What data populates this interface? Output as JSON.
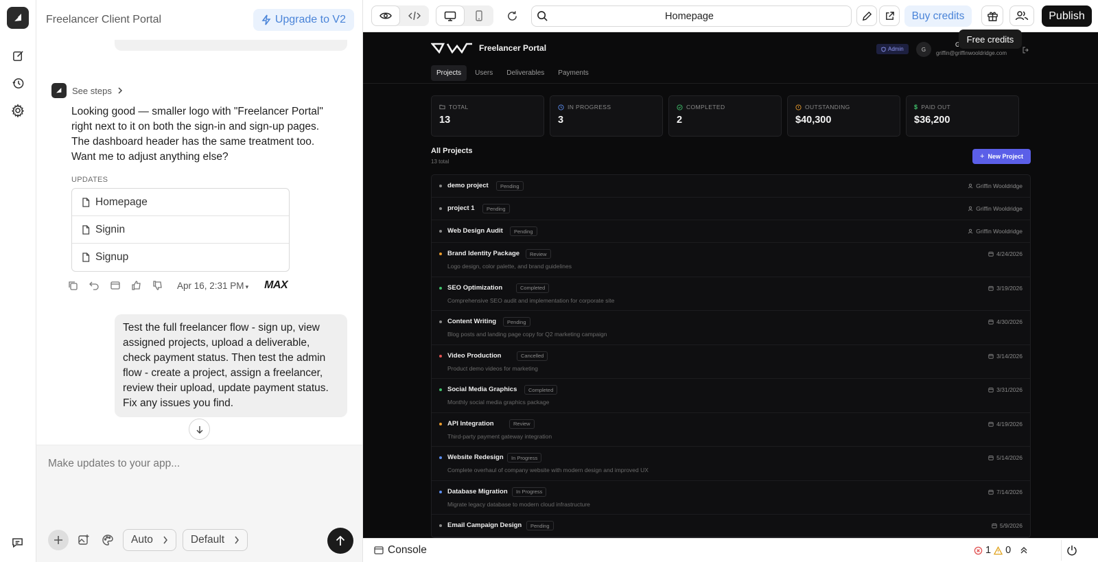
{
  "chat": {
    "title": "Freelancer Client Portal",
    "upgrade_label": "Upgrade to V2",
    "see_steps": "See steps",
    "assistant_message": "Looking good — smaller logo with \"Freelancer Portal\" right next to it on both the sign-in and sign-up pages. The dashboard header has the same treatment too. Want me to adjust anything else?",
    "updates_label": "UPDATES",
    "updated_files": [
      "Homepage",
      "Signin",
      "Signup"
    ],
    "timestamp": "Apr 16, 2:31 PM",
    "model_badge": "MAX",
    "user_message": "Test the full freelancer flow - sign up, view assigned projects, upload a deliverable, check payment status. Then test the admin flow - create a project, assign a freelancer, review their upload, update payment status. Fix any issues you find.",
    "composer_placeholder": "Make updates to your app...",
    "mode_pill": "Auto",
    "model_pill": "Default"
  },
  "toolbar": {
    "url_text": "Homepage",
    "buy_credits": "Buy credits",
    "publish": "Publish",
    "tooltip": "Free credits"
  },
  "app": {
    "brand_name": "Freelancer Portal",
    "admin_badge": "Admin",
    "avatar_initial": "G",
    "user_name_partial": "G",
    "user_email": "griffin@griffinwooldridge.com",
    "tabs": [
      "Projects",
      "Users",
      "Deliverables",
      "Payments"
    ],
    "active_tab": "Projects",
    "stats": [
      {
        "label": "TOTAL",
        "value": "13",
        "icon": "folder-icon",
        "color": "#8a8a8a"
      },
      {
        "label": "IN PROGRESS",
        "value": "3",
        "icon": "clock-icon",
        "color": "#5b8def"
      },
      {
        "label": "COMPLETED",
        "value": "2",
        "icon": "check-circle-icon",
        "color": "#3fbf6a"
      },
      {
        "label": "OUTSTANDING",
        "value": "$40,300",
        "icon": "alert-circle-icon",
        "color": "#e89a2c"
      },
      {
        "label": "PAID OUT",
        "value": "$36,200",
        "icon": "dollar-icon",
        "color": "#3fbf6a"
      }
    ],
    "projects_title": "All Projects",
    "projects_count": "13 total",
    "new_project": "New Project",
    "projects": [
      {
        "name": "demo project",
        "status": "Pending",
        "desc": "",
        "right": "Griffin Wooldridge",
        "right_icon": "user-icon",
        "dot": "#8a8a8a"
      },
      {
        "name": "project 1",
        "status": "Pending",
        "desc": "",
        "right": "Griffin Wooldridge",
        "right_icon": "user-icon",
        "dot": "#8a8a8a"
      },
      {
        "name": "Web Design Audit",
        "status": "Pending",
        "desc": "",
        "right": "Griffin Wooldridge",
        "right_icon": "user-icon",
        "dot": "#8a8a8a"
      },
      {
        "name": "Brand Identity Package",
        "status": "Review",
        "desc": "Logo design, color palette, and brand guidelines",
        "right": "4/24/2026",
        "right_icon": "calendar-icon",
        "dot": "#e89a2c"
      },
      {
        "name": "SEO Optimization",
        "status": "Completed",
        "desc": "Comprehensive SEO audit and implementation for corporate site",
        "right": "3/19/2026",
        "right_icon": "calendar-icon",
        "dot": "#3fbf6a"
      },
      {
        "name": "Content Writing",
        "status": "Pending",
        "desc": "Blog posts and landing page copy for Q2 marketing campaign",
        "right": "4/30/2026",
        "right_icon": "calendar-icon",
        "dot": "#8a8a8a"
      },
      {
        "name": "Video Production",
        "status": "Cancelled",
        "desc": "Product demo videos for marketing",
        "right": "3/14/2026",
        "right_icon": "calendar-icon",
        "dot": "#e05252"
      },
      {
        "name": "Social Media Graphics",
        "status": "Completed",
        "desc": "Monthly social media graphics package",
        "right": "3/31/2026",
        "right_icon": "calendar-icon",
        "dot": "#3fbf6a"
      },
      {
        "name": "API Integration",
        "status": "Review",
        "desc": "Third-party payment gateway integration",
        "right": "4/19/2026",
        "right_icon": "calendar-icon",
        "dot": "#e89a2c"
      },
      {
        "name": "Website Redesign",
        "status": "In Progress",
        "desc": "Complete overhaul of company website with modern design and improved UX",
        "right": "5/14/2026",
        "right_icon": "calendar-icon",
        "dot": "#5b8def"
      },
      {
        "name": "Database Migration",
        "status": "In Progress",
        "desc": "Migrate legacy database to modern cloud infrastructure",
        "right": "7/14/2026",
        "right_icon": "calendar-icon",
        "dot": "#5b8def"
      },
      {
        "name": "Email Campaign Design",
        "status": "Pending",
        "desc": "",
        "right": "5/9/2026",
        "right_icon": "calendar-icon",
        "dot": "#8a8a8a"
      }
    ]
  },
  "console": {
    "label": "Console",
    "errors": "1",
    "warnings": "0"
  }
}
